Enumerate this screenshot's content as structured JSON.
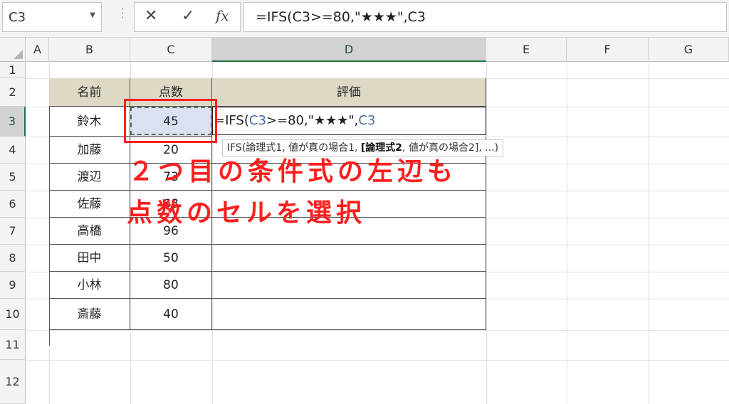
{
  "formula_bar": {
    "name_box": "C3",
    "cancel_icon": "✕",
    "enter_icon": "✓",
    "fx_label": "fx",
    "formula": "=IFS(C3>=80,\"★★★\",C3"
  },
  "columns": [
    "A",
    "B",
    "C",
    "D",
    "E",
    "F",
    "G"
  ],
  "rows": [
    "1",
    "2",
    "3",
    "4",
    "5",
    "6",
    "7",
    "8",
    "9",
    "10",
    "11",
    "12"
  ],
  "table": {
    "headers": [
      "名前",
      "点数",
      "評価"
    ],
    "rows": [
      {
        "name": "鈴木",
        "score": "45"
      },
      {
        "name": "加藤",
        "score": "20"
      },
      {
        "name": "渡辺",
        "score": "73"
      },
      {
        "name": "佐藤",
        "score": "68"
      },
      {
        "name": "高橋",
        "score": "96"
      },
      {
        "name": "田中",
        "score": "50"
      },
      {
        "name": "小林",
        "score": "80"
      },
      {
        "name": "斎藤",
        "score": "40"
      }
    ]
  },
  "edit_cell": {
    "p1": "=IFS(",
    "ref1": "C3",
    "p2": ">=80,\"★★★\",",
    "ref2": "C3"
  },
  "tooltip": {
    "pre": "IFS(論理式1, 値が真の場合1, ",
    "bold": "[論理式2",
    "post": ", 値が真の場合2], ...)"
  },
  "annotation": {
    "line1": "２つ目の条件式の左辺も",
    "line2": "点数のセルを選択"
  },
  "colors": {
    "accent": "#ff1e1e",
    "header_fill": "#ddd9c4",
    "selected_fill": "#d9e1f2",
    "excel_green": "#217346"
  }
}
